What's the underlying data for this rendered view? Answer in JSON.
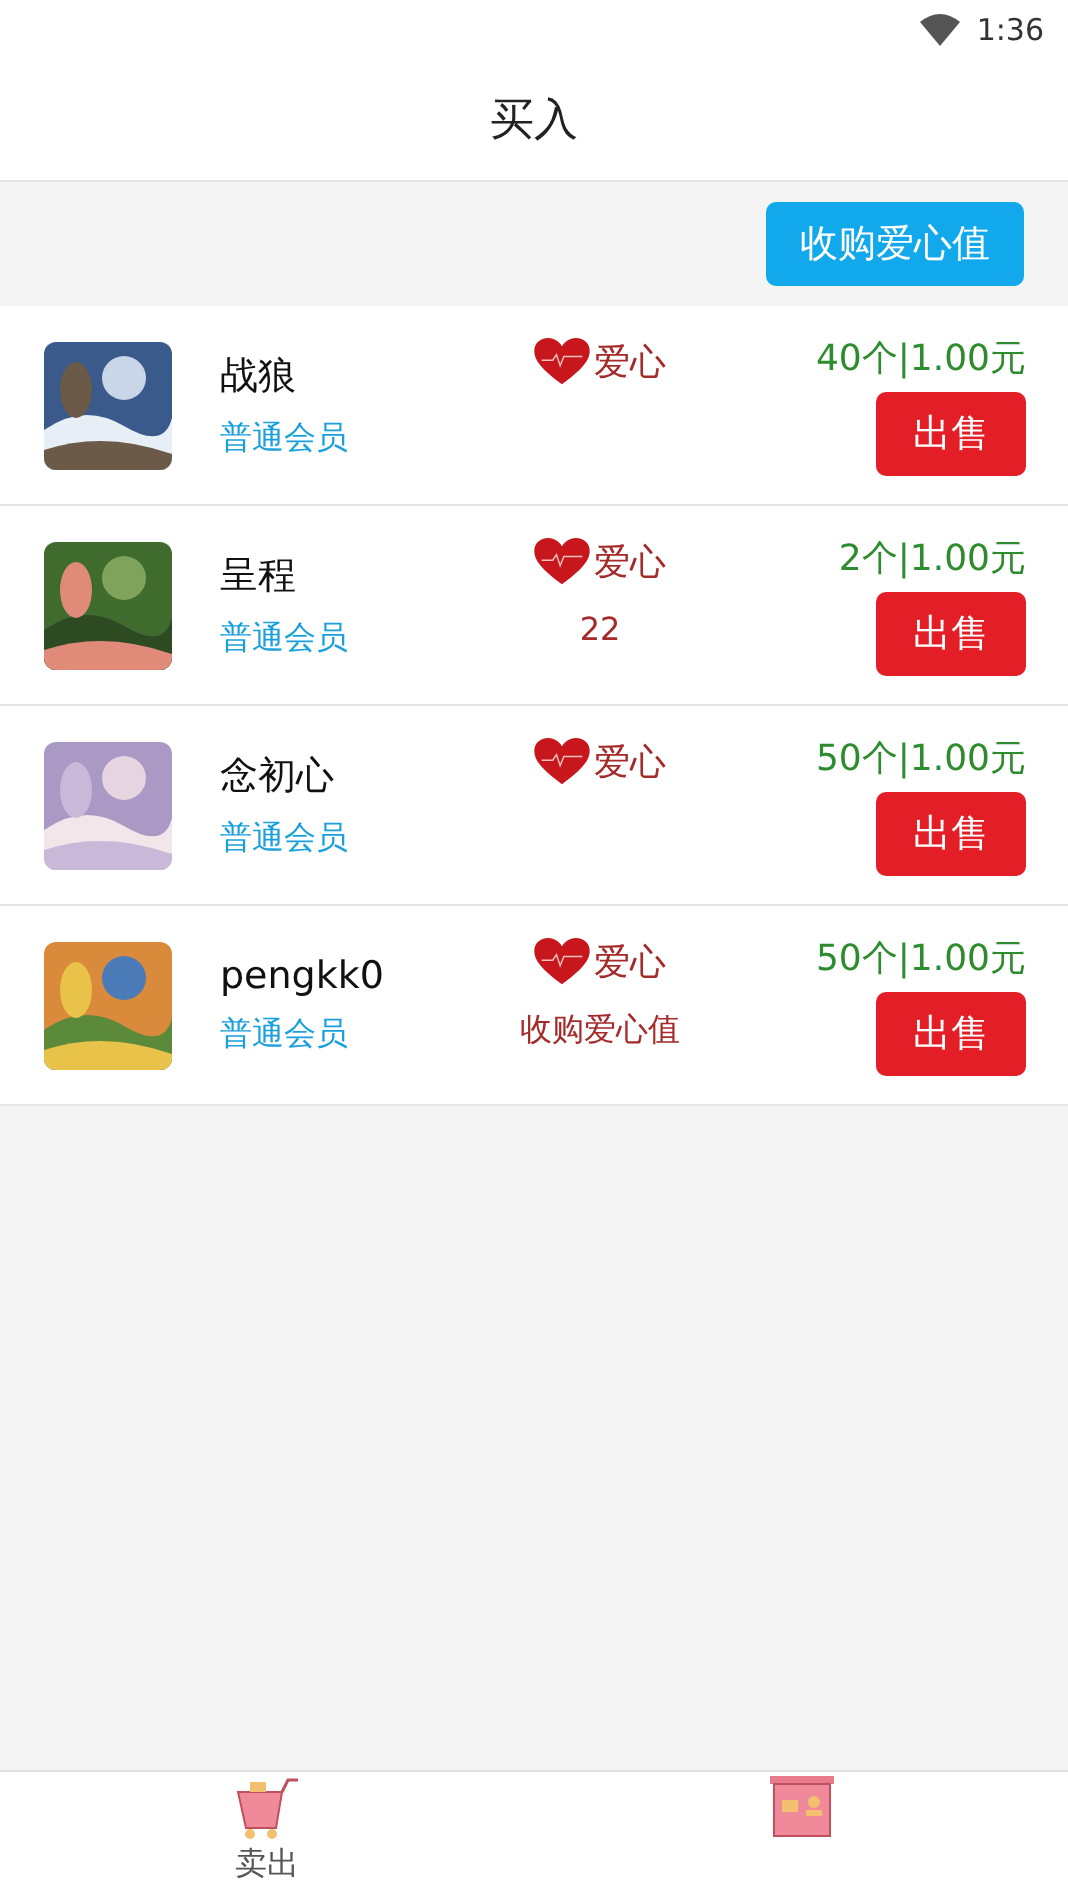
{
  "status_bar": {
    "time": "1:36"
  },
  "header": {
    "title": "买入"
  },
  "toolbar": {
    "button": "收购爱心值"
  },
  "rows": [
    {
      "name": "战狼",
      "member": "普通会员",
      "heart_label": "爱心",
      "price": "40个|1.00元",
      "action": "出售"
    },
    {
      "name": "呈程",
      "member": "普通会员",
      "heart_label": "爱心",
      "note": "22",
      "price": "2个|1.00元",
      "action": "出售"
    },
    {
      "name": "念初心",
      "member": "普通会员",
      "heart_label": "爱心",
      "price": "50个|1.00元",
      "action": "出售"
    },
    {
      "name": "pengkk0",
      "member": "普通会员",
      "heart_label": "爱心",
      "note": "收购爱心值",
      "price": "50个|1.00元",
      "action": "出售"
    }
  ],
  "tab_bar": [
    {
      "kind": "cart",
      "label": "卖出"
    },
    {
      "kind": "shop"
    }
  ]
}
